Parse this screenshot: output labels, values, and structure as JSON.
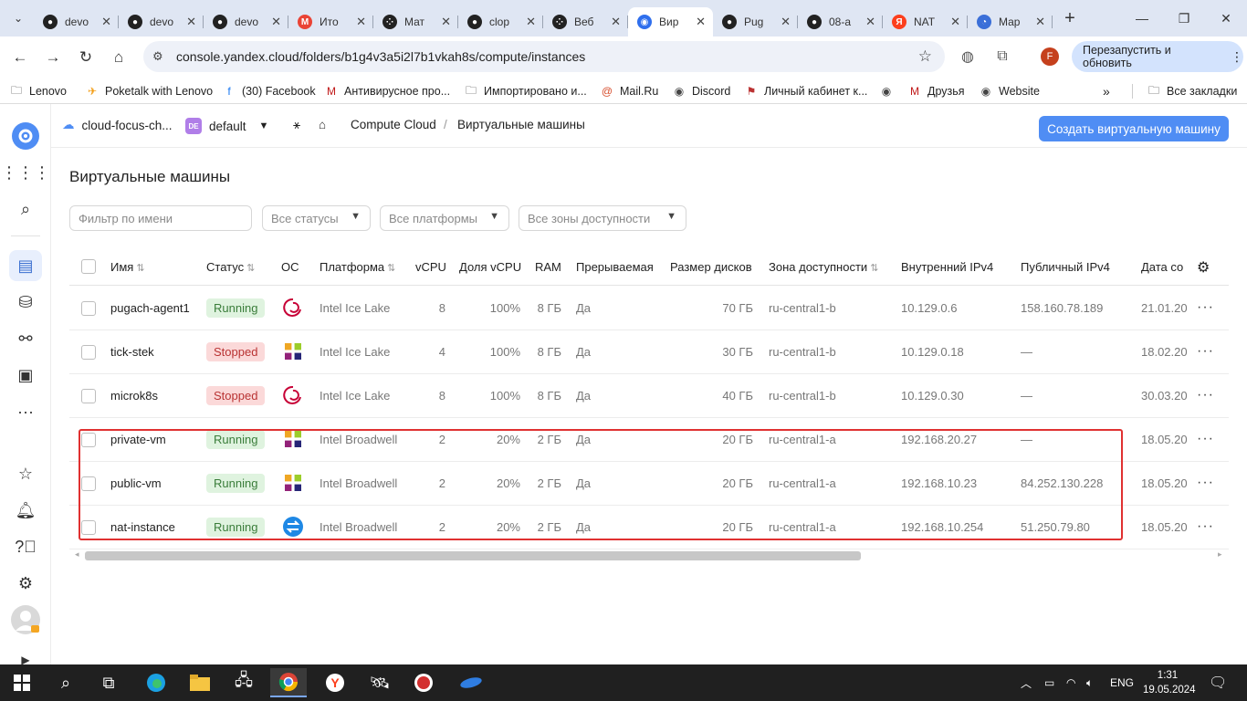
{
  "browser": {
    "tabs": [
      {
        "title": "devo",
        "icon": "github-icon",
        "color": "#222222"
      },
      {
        "title": "devo",
        "icon": "github-icon",
        "color": "#222222"
      },
      {
        "title": "devo",
        "icon": "github-icon",
        "color": "#222222"
      },
      {
        "title": "Ито",
        "icon": "gmail-icon",
        "color": "#ea4335"
      },
      {
        "title": "Мат",
        "icon": "dots-icon",
        "color": "#222222"
      },
      {
        "title": "clop",
        "icon": "github-icon",
        "color": "#222222"
      },
      {
        "title": "Веб",
        "icon": "dots-icon",
        "color": "#222222"
      },
      {
        "title": "Вир",
        "icon": "yandex-cloud-icon",
        "color": "#2f6fed"
      },
      {
        "title": "Pug",
        "icon": "github-icon",
        "color": "#222222"
      },
      {
        "title": "08-а",
        "icon": "github-icon",
        "color": "#222222"
      },
      {
        "title": "NAT",
        "icon": "yandex-icon",
        "color": "#fc3f1d"
      },
      {
        "title": "Мар",
        "icon": "circle-icon",
        "color": "#3b6fd8"
      }
    ],
    "active_tab_index": 7,
    "url": "console.yandex.cloud/folders/b1g4v3a5i2l7b1vkah8s/compute/instances",
    "profile_letter": "F",
    "restart_label": "Перезапустить и обновить",
    "bookmarks": [
      {
        "label": "Lenovo",
        "icon": "folder-icon"
      },
      {
        "label": "Poketalk with Lenovo",
        "icon": "poketalk-icon"
      },
      {
        "label": "(30) Facebook",
        "icon": "facebook-icon"
      },
      {
        "label": "Антивирусное про...",
        "icon": "mcafee-icon"
      },
      {
        "label": "Импортировано и...",
        "icon": "folder-icon"
      },
      {
        "label": "Mail.Ru",
        "icon": "mailru-icon"
      },
      {
        "label": "Discord",
        "icon": "globe-icon"
      },
      {
        "label": "Личный кабинет к...",
        "icon": "cabinet-icon"
      },
      {
        "label": "",
        "icon": "globe-icon"
      },
      {
        "label": "Друзья",
        "icon": "mcafee-icon"
      },
      {
        "label": "Website",
        "icon": "globe-icon"
      }
    ],
    "all_bookmarks_label": "Все закладки"
  },
  "topnav": {
    "cloud": "cloud-focus-ch...",
    "folder_badge": "DE",
    "folder": "default",
    "service": "Compute Cloud",
    "separator": "/",
    "page": "Виртуальные машины",
    "create_button": "Создать виртуальную машину"
  },
  "page": {
    "title": "Виртуальные машины",
    "filter_placeholder": "Фильтр по имени",
    "status_filter": "Все статусы",
    "platform_filter": "Все платформы",
    "zone_filter": "Все зоны доступности"
  },
  "table": {
    "columns": {
      "name": "Имя",
      "status": "Статус",
      "os": "ОС",
      "platform": "Платформа",
      "vcpu": "vCPU",
      "vcpu_share": "Доля vCPU",
      "ram": "RAM",
      "preemptible": "Прерываемая",
      "disk": "Размер дисков",
      "zone": "Зона доступности",
      "internal_ip": "Внутренний IPv4",
      "public_ip": "Публичный IPv4",
      "date": "Дата со"
    },
    "rows": [
      {
        "name": "pugach-agent1",
        "status": "Running",
        "status_kind": "run",
        "os": "debian-icon",
        "platform": "Intel Ice Lake",
        "vcpu": "8",
        "vcpu_share": "100%",
        "ram": "8 ГБ",
        "preemptible": "Да",
        "disk": "70 ГБ",
        "zone": "ru-central1-b",
        "internal_ip": "10.129.0.6",
        "public_ip": "158.160.78.189",
        "date": "21.01.20"
      },
      {
        "name": "tick-stek",
        "status": "Stopped",
        "status_kind": "stop",
        "os": "centos-icon",
        "platform": "Intel Ice Lake",
        "vcpu": "4",
        "vcpu_share": "100%",
        "ram": "8 ГБ",
        "preemptible": "Да",
        "disk": "30 ГБ",
        "zone": "ru-central1-b",
        "internal_ip": "10.129.0.18",
        "public_ip": "—",
        "date": "18.02.20"
      },
      {
        "name": "microk8s",
        "status": "Stopped",
        "status_kind": "stop",
        "os": "debian-icon",
        "platform": "Intel Ice Lake",
        "vcpu": "8",
        "vcpu_share": "100%",
        "ram": "8 ГБ",
        "preemptible": "Да",
        "disk": "40 ГБ",
        "zone": "ru-central1-b",
        "internal_ip": "10.129.0.30",
        "public_ip": "—",
        "date": "30.03.20"
      },
      {
        "name": "private-vm",
        "status": "Running",
        "status_kind": "run",
        "os": "centos-icon",
        "platform": "Intel Broadwell",
        "vcpu": "2",
        "vcpu_share": "20%",
        "ram": "2 ГБ",
        "preemptible": "Да",
        "disk": "20 ГБ",
        "zone": "ru-central1-a",
        "internal_ip": "192.168.20.27",
        "public_ip": "—",
        "date": "18.05.20"
      },
      {
        "name": "public-vm",
        "status": "Running",
        "status_kind": "run",
        "os": "centos-icon",
        "platform": "Intel Broadwell",
        "vcpu": "2",
        "vcpu_share": "20%",
        "ram": "2 ГБ",
        "preemptible": "Да",
        "disk": "20 ГБ",
        "zone": "ru-central1-a",
        "internal_ip": "192.168.10.23",
        "public_ip": "84.252.130.228",
        "date": "18.05.20"
      },
      {
        "name": "nat-instance",
        "status": "Running",
        "status_kind": "run",
        "os": "nat-icon",
        "platform": "Intel Broadwell",
        "vcpu": "2",
        "vcpu_share": "20%",
        "ram": "2 ГБ",
        "preemptible": "Да",
        "disk": "20 ГБ",
        "zone": "ru-central1-a",
        "internal_ip": "192.168.10.254",
        "public_ip": "51.250.79.80",
        "date": "18.05.20"
      }
    ]
  },
  "taskbar": {
    "lang": "ENG",
    "time": "1:31",
    "date": "19.05.2024"
  }
}
